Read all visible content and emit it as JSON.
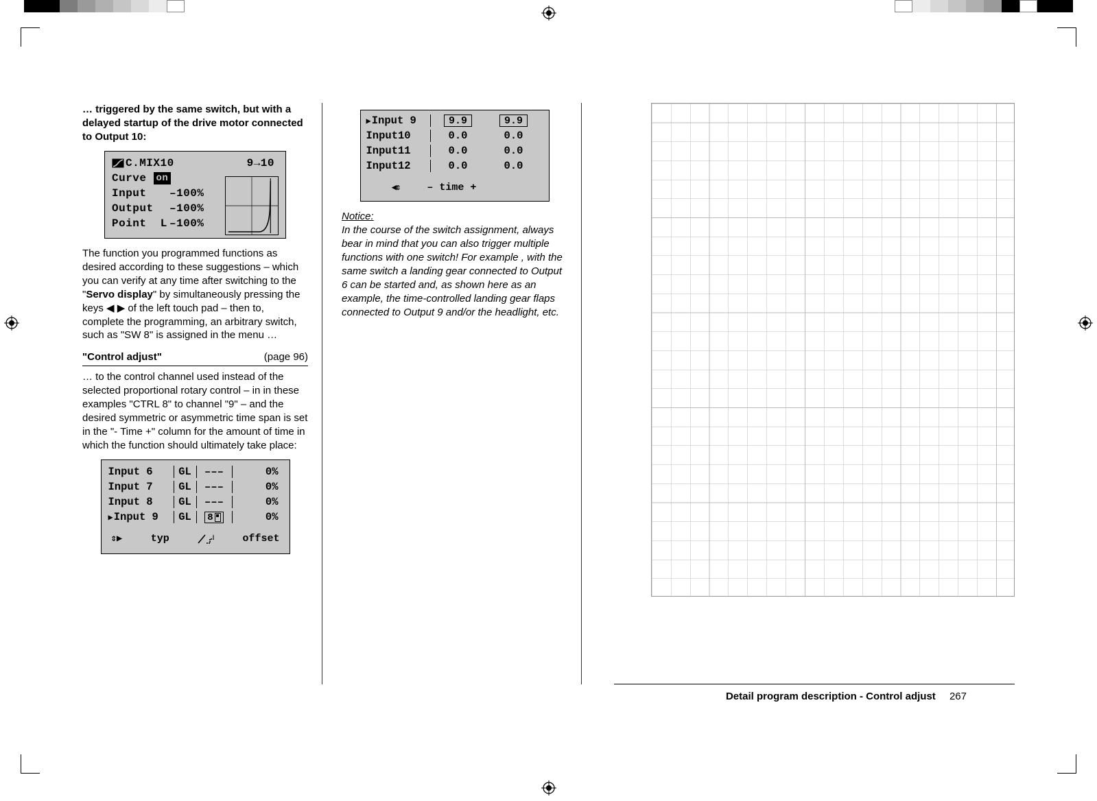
{
  "col1": {
    "intro": "… triggered by the same switch, but with a delayed startup of the drive motor connected to Output 10:",
    "lcd_cmix": {
      "title": "C.MIX10",
      "route": "9→10",
      "curve_label": "Curve",
      "curve_state": "on",
      "rows": [
        {
          "l": "Input",
          "v": "–100%"
        },
        {
          "l": "Output",
          "v": "–100%"
        },
        {
          "l": "Point  L",
          "v": "–100%"
        }
      ]
    },
    "para2_a": "The function you programmed functions as desired according to these suggestions  – which you can verify at any time after switching to the \"",
    "servo_display": "Servo display",
    "para2_b": "\" by simultaneously pressing the keys ◀ ▶ of the left touch pad  – then to, complete the programming, an arbitrary switch, such as \"SW 8\" is assigned in the menu …",
    "heading": "\"Control adjust\"",
    "pagelink": "(page 96)",
    "para3": "… to the control channel used instead of the selected proportional rotary control  – in in these examples \"CTRL 8\" to channel \"9\"  –   and the desired symmetric or asymmetric time span is set in the \"- Time +\" column for the amount of time in which the function should ultimately take place:",
    "lcd_inputs": {
      "rows": [
        {
          "name": "Input  6",
          "gl": "GL",
          "sw": "–––",
          "pct": "0%",
          "sel": false
        },
        {
          "name": "Input  7",
          "gl": "GL",
          "sw": "–––",
          "pct": "0%",
          "sel": false
        },
        {
          "name": "Input  8",
          "gl": "GL",
          "sw": "–––",
          "pct": "0%",
          "sel": false
        },
        {
          "name": "Input  9",
          "gl": "GL",
          "sw": "8",
          "pct": "0%",
          "sel": true
        }
      ],
      "footer_mid": "typ",
      "footer_right": "offset"
    }
  },
  "col2": {
    "lcd_time": {
      "rows": [
        {
          "name": "Input  9",
          "a": "9.9",
          "b": "9.9",
          "sel": true
        },
        {
          "name": "Input10",
          "a": "0.0",
          "b": "0.0",
          "sel": false
        },
        {
          "name": "Input11",
          "a": "0.0",
          "b": "0.0",
          "sel": false
        },
        {
          "name": "Input12",
          "a": "0.0",
          "b": "0.0",
          "sel": false
        }
      ],
      "footer": "– time +"
    },
    "notice_label": "Notice:",
    "notice_body": "In the course of the switch assignment, always bear in mind that you can also trigger multiple functions with one switch! For example , with the same switch a landing gear connected to Output 6 can be started and, as shown here as an example, the time-controlled landing gear flaps connected to Output 9 and/or the headlight, etc."
  },
  "footer": {
    "text": "Detail program description - Control adjust",
    "page": "267"
  },
  "colorbar": [
    "#000",
    "#000",
    "#7d7d7d",
    "#9a9a9a",
    "#b0b0b0",
    "#c5c5c5",
    "#d9d9d9",
    "#ececec",
    "#fff"
  ],
  "colorbar_r": [
    "#fff",
    "#ececec",
    "#d9d9d9",
    "#c5c5c5",
    "#b0b0b0",
    "#9a9a9a",
    "#000",
    "#fff",
    "#000",
    "#000"
  ]
}
